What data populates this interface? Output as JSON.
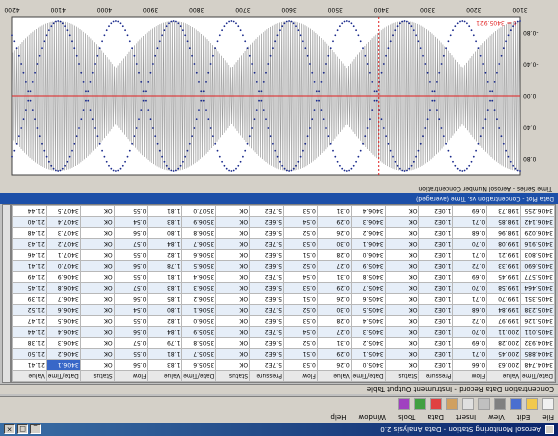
{
  "window": {
    "title": "Aerosol Monitoring Station - Data Analysis 2.0",
    "menu": [
      "File",
      "Edit",
      "View",
      "Insert",
      "Data",
      "Tools",
      "Window",
      "Help"
    ]
  },
  "toolbar": {
    "icons": [
      "new-icon",
      "open-icon",
      "save-icon",
      "print-icon",
      "cut-icon",
      "copy-icon",
      "paste-icon",
      "chart-icon",
      "table-icon",
      "zoom-icon"
    ]
  },
  "table_panel": {
    "title": "Concentration Data Record - Instrument Output Table",
    "columns": [
      "Date/Time",
      "Value",
      "Flow",
      "Pressure",
      "Status",
      "Date/Time",
      "Value",
      "Flow",
      "Pressure",
      "Status",
      "Date/Time",
      "Value",
      "Flow",
      "Status",
      "Date/Time",
      "Value"
    ],
    "rows": [
      [
        "3404.748",
        "200.63",
        "0.66",
        "1.0E2",
        "OK",
        "3405.0",
        "0.26",
        "0.53",
        "5.7E2",
        "OK",
        "3505.6",
        "1.83",
        "0.56",
        "OK",
        "3406.1",
        "21.41"
      ],
      [
        "3404.885",
        "200.45",
        "0.71",
        "1.0E2",
        "OK",
        "3405.1",
        "0.29",
        "0.51",
        "5.6E2",
        "OK",
        "3505.7",
        "1.81",
        "0.55",
        "OK",
        "3406.2",
        "21.50"
      ],
      [
        "3404.932",
        "200.28",
        "0.69",
        "1.0E2",
        "OK",
        "3405.2",
        "0.31",
        "0.52",
        "5.6E2",
        "OK",
        "3505.8",
        "1.79",
        "0.57",
        "OK",
        "3406.3",
        "21.38"
      ],
      [
        "3405.011",
        "200.11",
        "0.70",
        "1.0E2",
        "OK",
        "3405.3",
        "0.27",
        "0.54",
        "5.7E2",
        "OK",
        "3505.9",
        "1.84",
        "0.56",
        "OK",
        "3406.4",
        "21.44"
      ],
      [
        "3405.126",
        "199.97",
        "0.72",
        "1.0E2",
        "OK",
        "3405.4",
        "0.28",
        "0.53",
        "5.6E2",
        "OK",
        "3506.0",
        "1.82",
        "0.55",
        "OK",
        "3406.5",
        "21.47"
      ],
      [
        "3405.238",
        "199.84",
        "0.68",
        "1.0E2",
        "OK",
        "3405.5",
        "0.30",
        "0.52",
        "5.7E2",
        "OK",
        "3506.1",
        "1.80",
        "0.54",
        "OK",
        "3406.6",
        "21.52"
      ],
      [
        "3405.351",
        "199.70",
        "0.71",
        "1.0E2",
        "OK",
        "3405.6",
        "0.26",
        "0.51",
        "5.6E2",
        "OK",
        "3506.2",
        "1.85",
        "0.56",
        "OK",
        "3406.7",
        "21.39"
      ],
      [
        "3405.464",
        "199.58",
        "0.70",
        "1.0E2",
        "OK",
        "3405.7",
        "0.29",
        "0.53",
        "5.6E2",
        "OK",
        "3506.3",
        "1.83",
        "0.57",
        "OK",
        "3406.8",
        "21.45"
      ],
      [
        "3405.577",
        "199.45",
        "0.69",
        "1.0E2",
        "OK",
        "3405.8",
        "0.31",
        "0.54",
        "5.7E2",
        "OK",
        "3506.4",
        "1.81",
        "0.55",
        "OK",
        "3406.9",
        "21.49"
      ],
      [
        "3405.690",
        "199.33",
        "0.72",
        "1.0E2",
        "OK",
        "3405.9",
        "0.27",
        "0.52",
        "5.6E2",
        "OK",
        "3506.5",
        "1.78",
        "0.56",
        "OK",
        "3407.0",
        "21.41"
      ],
      [
        "3405.803",
        "199.21",
        "0.71",
        "1.0E2",
        "OK",
        "3406.0",
        "0.28",
        "0.51",
        "5.6E2",
        "OK",
        "3506.6",
        "1.82",
        "0.55",
        "OK",
        "3407.1",
        "21.46"
      ],
      [
        "3405.916",
        "199.08",
        "0.70",
        "1.0E2",
        "OK",
        "3406.1",
        "0.30",
        "0.53",
        "5.7E2",
        "OK",
        "3506.7",
        "1.84",
        "0.57",
        "OK",
        "3407.2",
        "21.43"
      ],
      [
        "3406.029",
        "198.96",
        "0.68",
        "1.0E2",
        "OK",
        "3406.2",
        "0.26",
        "0.52",
        "5.6E2",
        "OK",
        "3506.8",
        "1.80",
        "0.56",
        "OK",
        "3407.3",
        "21.48"
      ],
      [
        "3406.142",
        "198.85",
        "0.71",
        "1.0E2",
        "OK",
        "3406.3",
        "0.29",
        "0.54",
        "5.6E2",
        "OK",
        "3506.9",
        "1.83",
        "0.54",
        "OK",
        "3407.4",
        "21.40"
      ],
      [
        "3406.255",
        "198.73",
        "0.69",
        "1.0E2",
        "OK",
        "3406.4",
        "0.31",
        "0.53",
        "5.7E2",
        "OK",
        "3507.0",
        "1.81",
        "0.55",
        "OK",
        "3407.5",
        "21.44"
      ]
    ],
    "selected_row": 0,
    "selected_col": 14
  },
  "chart_panel": {
    "bar_title": "Data Plot - Concentration vs. Time (averaged)",
    "caption": "Time Series - Aerosol Number Concentration",
    "cursor_label": "t = 3405.921"
  },
  "chart_data": {
    "type": "line",
    "x_ticks": [
      "3100",
      "3200",
      "3300",
      "3400",
      "3500",
      "3600",
      "3700",
      "3800",
      "3900",
      "4000",
      "4100",
      "4200"
    ],
    "y_ticks": [
      "-0.80",
      "-0.40",
      "0.00",
      "0.40",
      "0.80"
    ],
    "xlim": [
      3100,
      4200
    ],
    "ylim": [
      -1,
      1
    ],
    "cursor_x": 3405.9,
    "reference_y": 0,
    "envelope_period": 250,
    "colors": {
      "signal": "#9a9a9a",
      "envelope": "#1a2a8c",
      "reference": "#e02020",
      "cursor": "#e02020",
      "plot_bg": "#ffffff"
    }
  }
}
